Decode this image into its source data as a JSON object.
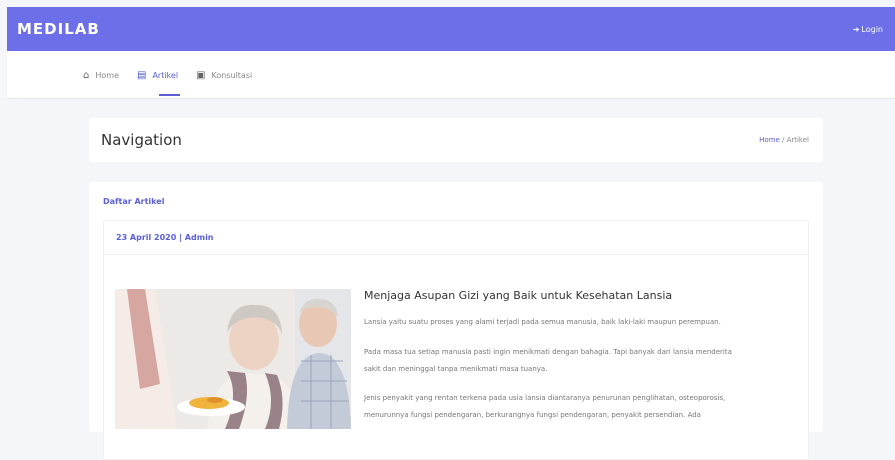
{
  "brand": "MEDILAB",
  "login": {
    "icon": "login-icon",
    "label": "Login"
  },
  "nav": [
    {
      "icon": "home-icon",
      "label": "Home"
    },
    {
      "icon": "article-icon",
      "label": "Artikel"
    },
    {
      "icon": "consult-icon",
      "label": "Konsultasi"
    }
  ],
  "header": {
    "title": "Navigation",
    "crumb_home": "Home",
    "crumb_sep": "/",
    "crumb_current": "Artikel"
  },
  "list": {
    "title": "Daftar Artikel"
  },
  "article": {
    "meta": "23 April 2020 | Admin",
    "title": "Menjaga Asupan Gizi yang Baik untuk Kesehatan Lansia",
    "p1": "Lansia yaitu suatu proses yang alami terjadi pada semua manusia, baik laki-laki maupun perempuan.",
    "p2a": "Pada masa tua setiap manusia pasti ingin menikmati dengan bahagia. Tapi banyak dari lansia menderita",
    "p2b": "sakit dan meninggal tanpa menikmati masa tuanya.",
    "p3a": "Jenis penyakit yang rentan terkena pada usia lansia diantaranya penurunan penglihatan, osteoporosis,",
    "p3b": "menurunnya fungsi pendengaran, berkurangnya fungsi pendengaran, penyakit persendian. Ada"
  }
}
